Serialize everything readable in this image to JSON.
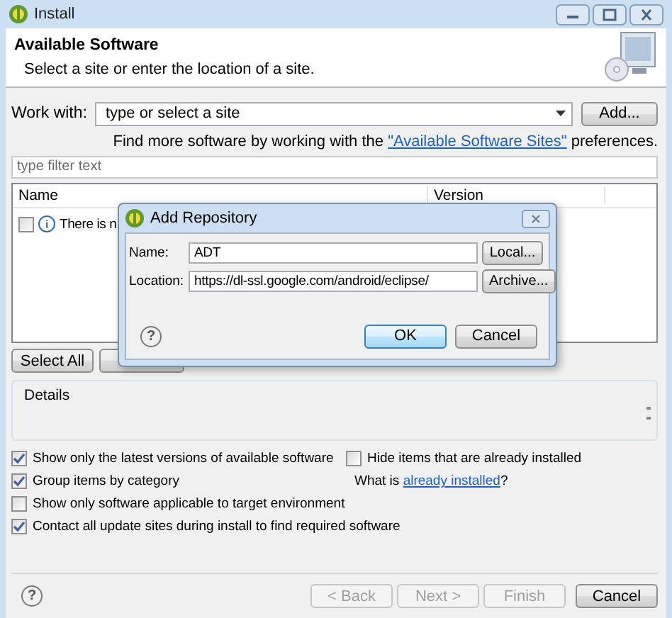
{
  "window": {
    "title": "Install"
  },
  "header": {
    "title": "Available Software",
    "subtitle": "Select a site or enter the location of a site."
  },
  "work_with": {
    "label": "Work with:",
    "placeholder": "type or select a site",
    "button": "Add..."
  },
  "sites_hint": {
    "text": "Find more software by working with the ",
    "link": "\"Available Software Sites\"",
    "suffix": " preferences."
  },
  "filter": {
    "placeholder": "type filter text"
  },
  "table": {
    "columns": [
      "Name",
      "Version"
    ],
    "rows": [
      {
        "checked": false,
        "info_icon": "i",
        "text": "There is n"
      }
    ]
  },
  "table_buttons": [
    "Select All"
  ],
  "details": {
    "title": "Details"
  },
  "options": [
    {
      "label": "Show only the latest versions of available software",
      "checked": true
    },
    {
      "label": "Group items by category",
      "checked": true
    },
    {
      "label": "Show only software applicable to target environment",
      "checked": false
    },
    {
      "label": "Contact all update sites during install to find required software",
      "checked": true
    }
  ],
  "hide_installed": {
    "label": "Hide items that are already installed",
    "checked": false
  },
  "installed_hint": {
    "text": "What is ",
    "link": "already installed",
    "suffix": "?"
  },
  "help_icon": "?",
  "footer_buttons": [
    {
      "label": "< Back",
      "disabled": true
    },
    {
      "label": "Next >",
      "disabled": true
    },
    {
      "label": "Finish",
      "disabled": true
    },
    {
      "label": "Cancel",
      "disabled": false
    }
  ],
  "dialog": {
    "title": "Add Repository",
    "help_icon": "?",
    "fields": [
      {
        "label": "Name:",
        "value": "ADT",
        "button": "Local..."
      },
      {
        "label": "Location:",
        "value": "https://dl-ssl.google.com/android/eclipse/",
        "button": "Archive..."
      }
    ],
    "buttons": [
      {
        "label": "OK",
        "default": true
      },
      {
        "label": "Cancel",
        "default": false
      }
    ]
  }
}
